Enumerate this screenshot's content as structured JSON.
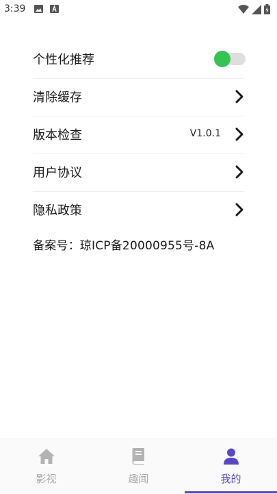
{
  "status_bar": {
    "time": "3:39"
  },
  "settings": {
    "personalized": {
      "label": "个性化推荐",
      "enabled": true
    },
    "clear_cache": {
      "label": "清除缓存"
    },
    "version_check": {
      "label": "版本检查",
      "value": "V1.0.1"
    },
    "user_agreement": {
      "label": "用户协议"
    },
    "privacy_policy": {
      "label": "隐私政策"
    }
  },
  "record_number": "备案号：琼ICP备20000955号-8A",
  "bottom_nav": {
    "items": [
      {
        "label": "影视",
        "icon": "home-icon"
      },
      {
        "label": "趣闻",
        "icon": "book-icon"
      },
      {
        "label": "我的",
        "icon": "person-icon"
      }
    ],
    "active": "我的"
  },
  "colors": {
    "accent": "#5b47c6",
    "toggle_on": "#35c454",
    "inactive": "#aaaaaa"
  }
}
